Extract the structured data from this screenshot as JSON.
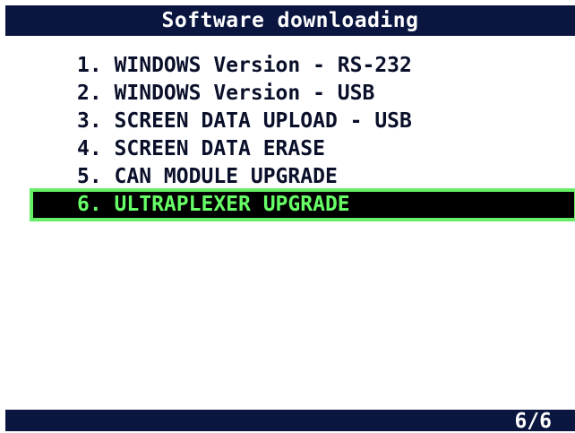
{
  "header": {
    "title": "Software downloading"
  },
  "menu": {
    "items": [
      {
        "label": "1. WINDOWS Version - RS-232",
        "selected": false
      },
      {
        "label": "2. WINDOWS Version - USB",
        "selected": false
      },
      {
        "label": "3. SCREEN DATA UPLOAD - USB",
        "selected": false
      },
      {
        "label": "4. SCREEN DATA ERASE",
        "selected": false
      },
      {
        "label": "5. CAN MODULE UPGRADE",
        "selected": false
      },
      {
        "label": "6. ULTRAPLEXER UPGRADE",
        "selected": true
      }
    ]
  },
  "status": {
    "page": "6/6"
  },
  "colors": {
    "bar_background": "#0a1640",
    "text": "#0a0f2a",
    "highlight_background": "#000000",
    "highlight_text": "#66ff66",
    "highlight_border": "#66ee66"
  }
}
